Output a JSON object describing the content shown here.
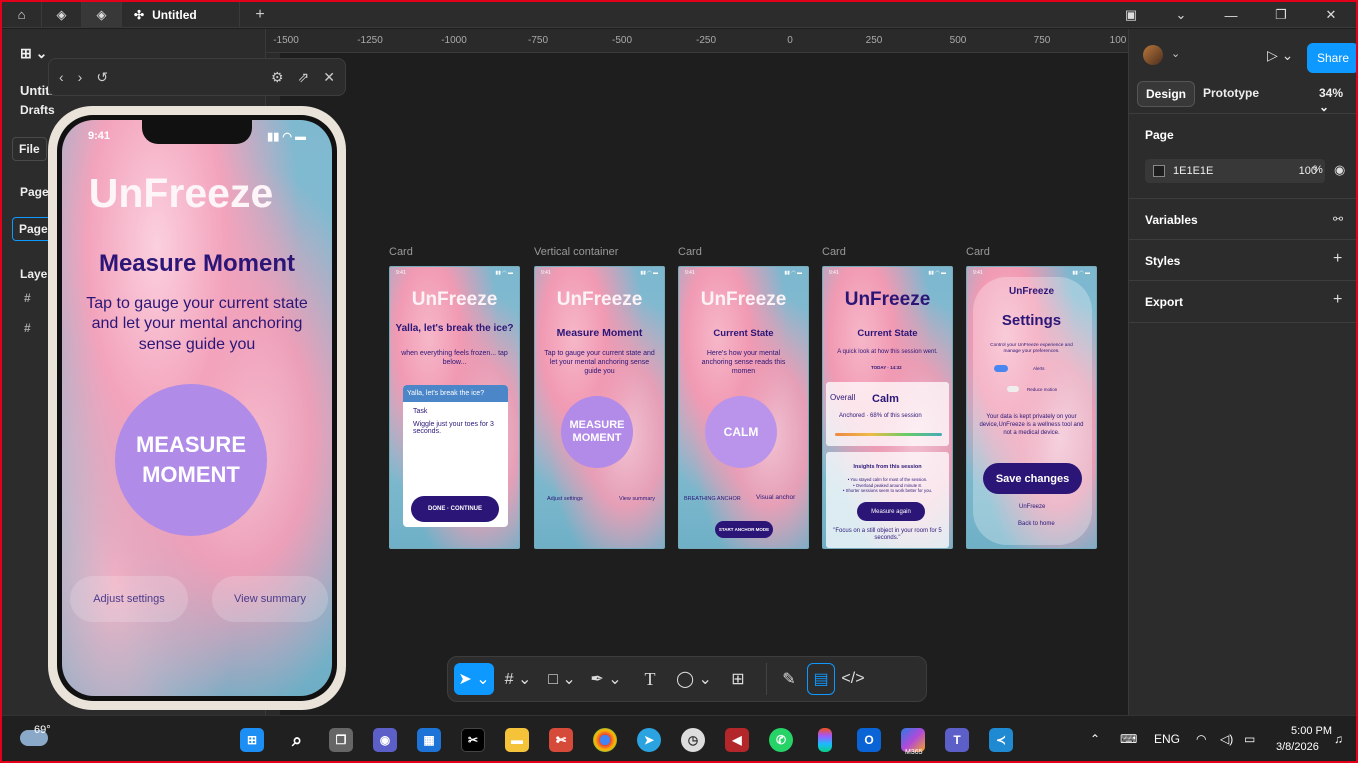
{
  "titlebar": {
    "tab_title": "Untitled",
    "plus": "+"
  },
  "left_panel": {
    "file_title": "Untitl",
    "drafts": "Drafts",
    "file_btn": "File",
    "pages": "Pages",
    "page_item": "Page",
    "layers": "Layers"
  },
  "preview_bar": {
    "back": "‹",
    "forward": "›",
    "reset": "↺",
    "settings": "⚙",
    "open": "⇗",
    "close": "✕"
  },
  "ruler": {
    "ticks": [
      "-1500",
      "-1250",
      "-1000",
      "-750",
      "-500",
      "-250",
      "0",
      "250",
      "500",
      "750",
      "100"
    ]
  },
  "frames": [
    {
      "label": "Card",
      "time": "9:41",
      "logo": "UnFreeze",
      "heading": "Yalla, let's break the ice?",
      "sub": "when everything feels frozen... tap below...",
      "card_header": "Yalla, let's break the ice?",
      "task_label": "Task",
      "task_text": "Wiggle just your toes for 3 seconds.",
      "cta": "DONE · CONTINUE"
    },
    {
      "label": "Vertical container",
      "time": "9:41",
      "logo": "UnFreeze",
      "heading": "Measure Moment",
      "sub": "Tap to gauge your current state and let your mental anchoring sense guide you",
      "circle": "MEASURE MOMENT",
      "left_btn": "Adjust settings",
      "right_btn": "View summary"
    },
    {
      "label": "Card",
      "time": "9:41",
      "logo": "UnFreeze",
      "heading": "Current State",
      "sub": "Here's how your mental anchoring sense reads this momen",
      "circle": "CALM",
      "left_btn": "BREATHING ANCHOR",
      "right_btn": "Visual anchor",
      "cta": "START ANCHOR MODE"
    },
    {
      "label": "Card",
      "time": "9:41",
      "logo": "UnFreeze",
      "heading": "Current State",
      "sub": "A quick look at how this session went.",
      "date": "TODAY · 14:32",
      "overall": "Overall",
      "state": "Calm",
      "anchored": "Anchored · 68% of this session",
      "insights_title": "Insights from this session",
      "insights": "• You stayed calm for most of the session.\n• Overload peaked around minute 8.\n• Shorter sessions seem to work better for you.",
      "cta": "Measure again",
      "quote": "\"Focus on a still object in your room for 5 seconds.\""
    },
    {
      "label": "Card",
      "time": "9:41",
      "logo": "UnFreeze",
      "heading": "Settings",
      "sub": "Control your UnFreeze experience and manage your preferences.",
      "toggle1": "Alerts",
      "toggle2": "Reduce motion",
      "privacy": "Your data is kept privately on your device,UnFreeze is a wellness tool and not a medical device.",
      "cta": "Save changes",
      "link1": "UnFreeze",
      "link2": "Back to home"
    }
  ],
  "phone": {
    "time": "9:41",
    "logo": "UnFreeze",
    "heading": "Measure Moment",
    "sub": "Tap to gauge your current state and let your mental anchoring sense guide you",
    "circle": "MEASURE MOMENT",
    "left_btn": "Adjust settings",
    "right_btn": "View summary"
  },
  "right_panel": {
    "share": "Share",
    "design_tab": "Design",
    "prototype_tab": "Prototype",
    "zoom": "34%",
    "page_title": "Page",
    "page_color": "1E1E1E",
    "page_opacity": "100",
    "percent": "%",
    "variables": "Variables",
    "styles": "Styles",
    "export": "Export"
  },
  "taskbar": {
    "weather": "69°",
    "lang": "ENG",
    "time": "5:00 PM",
    "date": "3/8/2026",
    "m365": "M365"
  },
  "help": "?"
}
